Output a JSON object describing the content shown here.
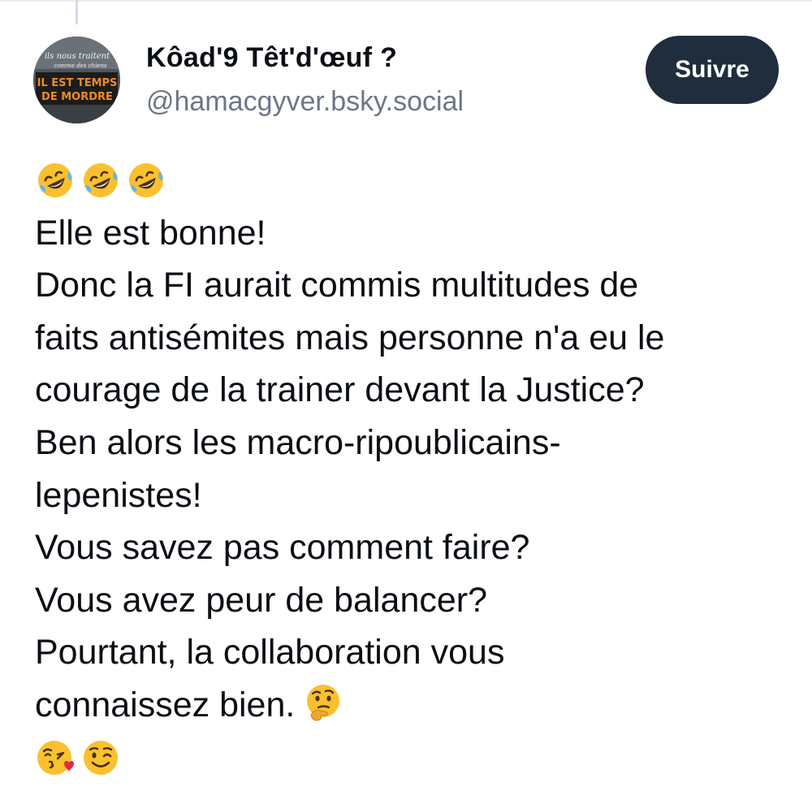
{
  "author": {
    "display_name": "Kôad'9 Têt'd'œuf ?",
    "handle": "@hamacgyver.bsky.social",
    "avatar_text": [
      "ils nous traitent",
      "comme des chiens",
      "IL EST TEMPS",
      "DE MORDRE"
    ]
  },
  "follow_button": {
    "label": "Suivre"
  },
  "post": {
    "emoji_top": [
      "rolling-on-floor-laughing",
      "rolling-on-floor-laughing",
      "rolling-on-floor-laughing"
    ],
    "lines": [
      "Elle est bonne!",
      "Donc la FI aurait commis multitudes de",
      "faits antisémites mais personne n'a eu le",
      "courage de la trainer devant la Justice?",
      "Ben alors les macro-ripoublicains-",
      "lepenistes!",
      "Vous savez pas comment faire?",
      "Vous avez peur de balancer?",
      "Pourtant, la collaboration vous",
      "connaissez bien."
    ],
    "inline_emoji": "thinking-face",
    "emoji_bottom": [
      "face-blowing-a-kiss",
      "winking-face"
    ]
  },
  "colors": {
    "button_bg": "#1f2d3d",
    "handle_gray": "#6b7785",
    "text": "#0b0f14",
    "emoji_yellow": "#f9c12e"
  }
}
